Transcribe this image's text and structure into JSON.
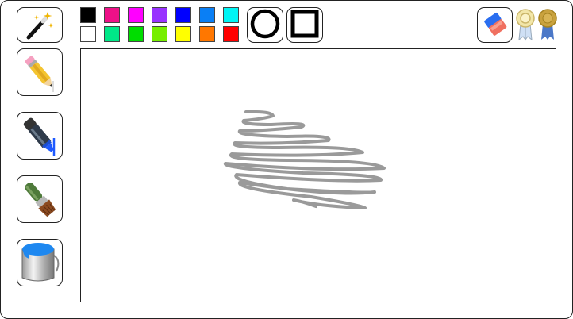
{
  "tools": [
    {
      "name": "magic-wand",
      "icon": "magic-wand-icon"
    },
    {
      "name": "pencil",
      "icon": "pencil-icon"
    },
    {
      "name": "marker",
      "icon": "marker-icon"
    },
    {
      "name": "brush",
      "icon": "paintbrush-icon"
    },
    {
      "name": "paint-bucket",
      "icon": "paint-bucket-icon"
    }
  ],
  "palette": {
    "row1": [
      "#000000",
      "#ee1188",
      "#ff00ff",
      "#9933ff",
      "#0000ff",
      "#0a7ff5",
      "#00f5f5"
    ],
    "row2": [
      "#ffffff",
      "#00e888",
      "#00dd00",
      "#77ee00",
      "#ffff00",
      "#ff7700",
      "#ff0000"
    ]
  },
  "shapes": [
    "circle-outline",
    "square-outline"
  ],
  "top_right": {
    "eraser_icon": "eraser-icon",
    "awards": [
      "silver-award-icon",
      "gold-award-icon"
    ]
  },
  "canvas": {
    "stroke_color": "#9a9a9a"
  }
}
